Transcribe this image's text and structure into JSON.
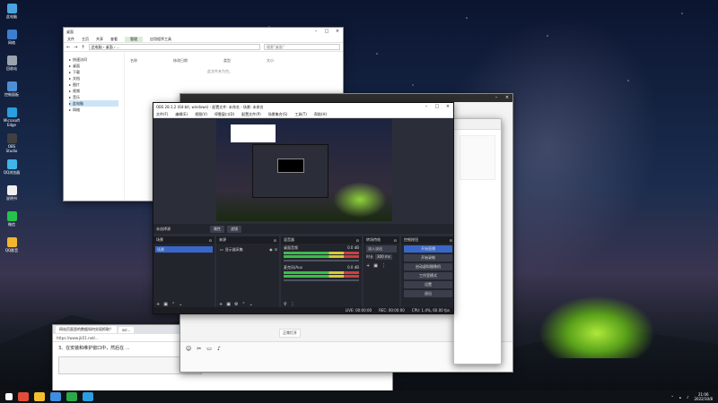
{
  "desktop": {
    "icons": [
      {
        "label": "此电脑",
        "color": "#4aa3e0"
      },
      {
        "label": "网络",
        "color": "#3b7fd1"
      },
      {
        "label": "回收站",
        "color": "#9aa4ad"
      },
      {
        "label": "控制面板",
        "color": "#4d8fd6"
      },
      {
        "label": "Microsoft Edge",
        "color": "#2a9ee0"
      },
      {
        "label": "OBS Studio",
        "color": "#404040"
      },
      {
        "label": "QQ浏览器",
        "color": "#3fb5e8"
      },
      {
        "label": "说明书",
        "color": "#f0f0f0"
      },
      {
        "label": "微信",
        "color": "#27c24c"
      },
      {
        "label": "QQ影音",
        "color": "#f1b62c"
      }
    ]
  },
  "explorer": {
    "title": "桌面",
    "ribbon": [
      "文件",
      "主页",
      "共享",
      "查看",
      "管理",
      "应用程序工具"
    ],
    "ribbon_active": "管理",
    "path": "此电脑 › 桌面 › ...",
    "search_placeholder": "搜索\"桌面\"",
    "nav": [
      "快速访问",
      "桌面",
      "下载",
      "文档",
      "图片",
      "视频",
      "音乐",
      "此电脑",
      "网络"
    ],
    "nav_selected": "此电脑",
    "columns": [
      "名称",
      "修改日期",
      "类型",
      "大小"
    ],
    "empty_text": "此文件夹为空。"
  },
  "obs": {
    "title": "OBS 28.1.2 (64-bit, windows) - 配置文件: 未命名 - 场景: 未命名",
    "menu": [
      "文件(F)",
      "编辑(E)",
      "视图(V)",
      "停靠窗口(D)",
      "配置文件(P)",
      "场景集合(S)",
      "工具(T)",
      "帮助(H)"
    ],
    "no_source": "未选择源",
    "prop_btn": "属性",
    "filter_btn": "滤镜",
    "docks": {
      "scenes": {
        "title": "场景",
        "items": [
          "场景"
        ]
      },
      "sources": {
        "title": "来源",
        "items": [
          "显示器采集"
        ]
      },
      "mixer": {
        "title": "混音器",
        "rows": [
          {
            "name": "桌面音频",
            "db": "0.0 dB"
          },
          {
            "name": "麦克风/Aux",
            "db": "0.0 dB"
          }
        ]
      },
      "transitions": {
        "title": "转场特效",
        "type": "淡入淡出",
        "duration_label": "时长",
        "duration": "300 ms"
      },
      "controls": {
        "title": "控制按钮",
        "buttons": [
          "开始直播",
          "开始录制",
          "启动虚拟摄像机",
          "工作室模式",
          "设置",
          "退出"
        ]
      }
    },
    "status": {
      "live": "LIVE: 00:00:00",
      "rec": "REC: 00:00:00",
      "cpu": "CPU: 1.4%, 60.00 fps"
    }
  },
  "browser": {
    "tabs": [
      "网站页面里的数据如何实现抓取？",
      "scr..."
    ],
    "url": "https://www.jb51.net/...",
    "line": "3、在安装和维护窗口中，然后在 ..."
  },
  "chat": {
    "big_char": "快",
    "message": "正常打开"
  },
  "taskbar": {
    "time": "21:06",
    "date": "2022/10/8"
  }
}
